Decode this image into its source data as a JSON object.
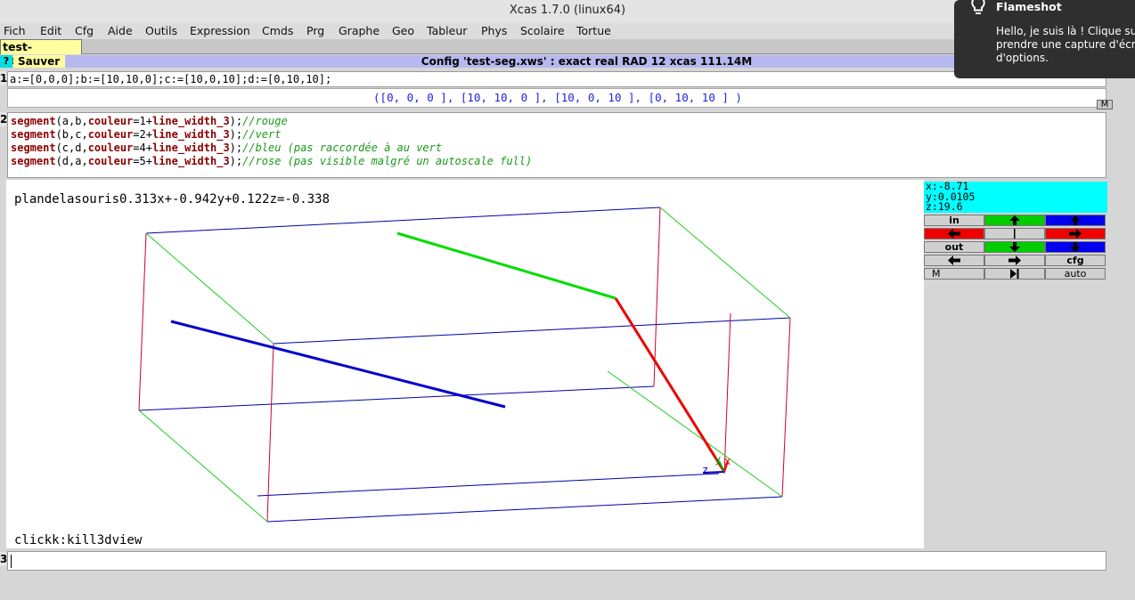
{
  "window": {
    "title": "Xcas 1.7.0 (linux64)"
  },
  "menu": [
    "Fich",
    "Edit",
    "Cfg",
    "Aide",
    "Outils",
    "Expression",
    "Cmds",
    "Prg",
    "Graphe",
    "Geo",
    "Tableur",
    "Phys",
    "Scolaire",
    "Tortue"
  ],
  "tab": {
    "label": "test-seg.xws"
  },
  "toolbar": {
    "help_label": "?",
    "save_label": "Sauver",
    "config_text": "Config 'test-seg.xws' : exact real RAD 12 xcas 111.14M"
  },
  "levels": {
    "l1": {
      "number": "1",
      "input": "a:=[0,0,0];b:=[10,10,0];c:=[10,0,10];d:=[0,10,10];",
      "output": "([0, 0, 0 ], [10, 10, 0 ], [10, 0, 10 ], [0, 10, 10 ] )",
      "m_label": "M"
    },
    "l2": {
      "number": "2",
      "code": [
        {
          "fn": "segment",
          "args": "(a,b,",
          "kw": "couleur",
          "val": "=1+",
          "lw": "line_width_3",
          "end": ");",
          "comment": "//rouge"
        },
        {
          "fn": "segment",
          "args": "(b,c,",
          "kw": "couleur",
          "val": "=2+",
          "lw": "line_width_3",
          "end": ");",
          "comment": "//vert"
        },
        {
          "fn": "segment",
          "args": "(c,d,",
          "kw": "couleur",
          "val": "=4+",
          "lw": "line_width_3",
          "end": ");",
          "comment": "//bleu (pas raccordée à au vert"
        },
        {
          "fn": "segment",
          "args": "(d,a,",
          "kw": "couleur",
          "val": "=5+",
          "lw": "line_width_3",
          "end": ");",
          "comment": "//rose (pas visible malgré un autoscale full)"
        }
      ]
    },
    "l3": {
      "number": "3"
    }
  },
  "graph": {
    "mouse_plane": "plandelasouris0.313x+-0.942y+0.122z=-0.338",
    "click_hint": "clickk:kill3dview",
    "axis_labels": {
      "x": "x",
      "y": "y",
      "z": "z"
    }
  },
  "coords": {
    "x": "x:-8.71",
    "y": "y:0.0105",
    "z": "z:19.6"
  },
  "controls": {
    "in_label": "in",
    "out_label": "out",
    "cfg_label": "cfg",
    "m_label": "M",
    "auto_label": "auto"
  },
  "colors": {
    "red_segment": "#ee0000",
    "green_segment": "#00dd00",
    "blue_segment": "#0000cc",
    "cyan_panel": "#00ffff",
    "config_bar": "#b8b8f0"
  },
  "notification": {
    "title": "Flameshot",
    "body": "Hello, je suis là ! Clique sur\nprendre une capture d'écran\nd'options."
  }
}
